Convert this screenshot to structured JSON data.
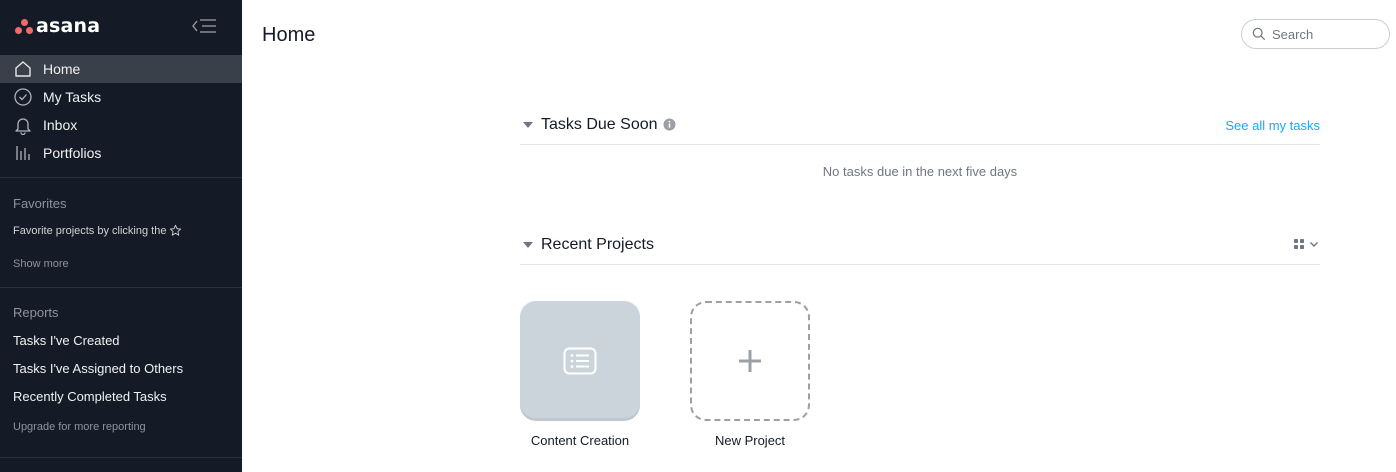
{
  "brand": {
    "name": "asana"
  },
  "sidebar": {
    "nav": [
      {
        "label": "Home",
        "icon": "home-icon",
        "active": true
      },
      {
        "label": "My Tasks",
        "icon": "check-circle-icon"
      },
      {
        "label": "Inbox",
        "icon": "bell-icon"
      },
      {
        "label": "Portfolios",
        "icon": "bar-chart-icon"
      }
    ],
    "favorites": {
      "heading": "Favorites",
      "hint": "Favorite projects by clicking the",
      "show_more": "Show more"
    },
    "reports": {
      "heading": "Reports",
      "items": [
        "Tasks I've Created",
        "Tasks I've Assigned to Others",
        "Recently Completed Tasks"
      ],
      "upgrade": "Upgrade for more reporting"
    }
  },
  "header": {
    "title": "Home",
    "search_placeholder": "Search"
  },
  "tasks_due": {
    "title": "Tasks Due Soon",
    "see_all": "See all my tasks",
    "empty": "No tasks due in the next five days"
  },
  "recent_projects": {
    "title": "Recent Projects",
    "projects": [
      {
        "name": "Content Creation",
        "icon": "list-icon"
      }
    ],
    "new_label": "New Project"
  },
  "colors": {
    "sidebar_bg": "#151b26",
    "brand_coral": "#f06a6a",
    "link_blue": "#14aaf5",
    "tile_gray": "#cbd4db"
  }
}
